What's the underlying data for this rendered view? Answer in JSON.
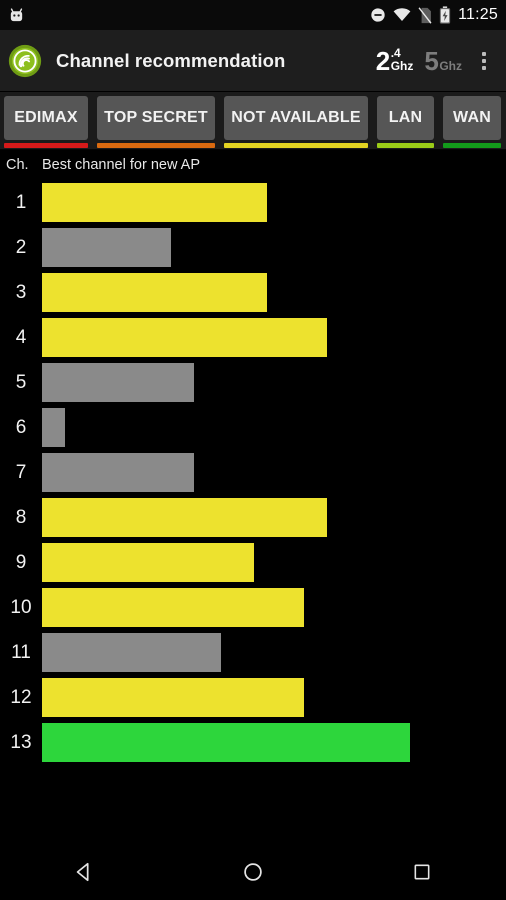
{
  "status_bar": {
    "notification_icon": "android-robot-icon",
    "icons": [
      "do-not-disturb-icon",
      "wifi-icon",
      "no-sim-icon",
      "battery-charging-icon"
    ],
    "time": "11:25"
  },
  "app_bar": {
    "logo_icon": "wifi-analyzer-logo-icon",
    "title": "Channel recommendation",
    "band_24": {
      "number": "2",
      "decimal": ".4",
      "unit": "Ghz",
      "active": true
    },
    "band_5": {
      "number": "5",
      "decimal": "",
      "unit": "Ghz",
      "active": false
    },
    "overflow_icon": "more-vert-icon"
  },
  "tabs": [
    {
      "label": "EDIMAX",
      "color": "#d51a1a"
    },
    {
      "label": "TOP SECRET",
      "color": "#da6a10"
    },
    {
      "label": "NOT AVAILABLE",
      "color": "#e3d322"
    },
    {
      "label": "LAN",
      "color": "#9bcc18"
    },
    {
      "label": "WAN",
      "color": "#139b1b"
    }
  ],
  "chart_header": {
    "channel_column": "Ch.",
    "title": "Best channel for new AP"
  },
  "colors": {
    "good": "#2DD63C",
    "medium": "#EDE22E",
    "poor": "#8A8A8A",
    "background": "#000000"
  },
  "chart_data": {
    "type": "bar",
    "orientation": "horizontal",
    "title": "Best channel for new AP",
    "xlabel": "",
    "ylabel": "Ch.",
    "categories": [
      "1",
      "2",
      "3",
      "4",
      "5",
      "6",
      "7",
      "8",
      "9",
      "10",
      "11",
      "12",
      "13"
    ],
    "values": [
      49,
      28,
      49,
      62,
      33,
      5,
      33,
      62,
      46,
      57,
      39,
      57,
      80
    ],
    "xlim": [
      0,
      100
    ],
    "grid": false,
    "legend": null,
    "bar_colors": [
      "#EDE22E",
      "#8A8A8A",
      "#EDE22E",
      "#EDE22E",
      "#8A8A8A",
      "#8A8A8A",
      "#8A8A8A",
      "#EDE22E",
      "#EDE22E",
      "#EDE22E",
      "#8A8A8A",
      "#EDE22E",
      "#2DD63C"
    ],
    "ratings": [
      "medium",
      "poor",
      "medium",
      "medium",
      "poor",
      "poor",
      "poor",
      "medium",
      "medium",
      "medium",
      "poor",
      "medium",
      "good"
    ]
  },
  "nav_bar": {
    "back": "back-icon",
    "home": "home-icon",
    "recents": "recents-icon"
  }
}
